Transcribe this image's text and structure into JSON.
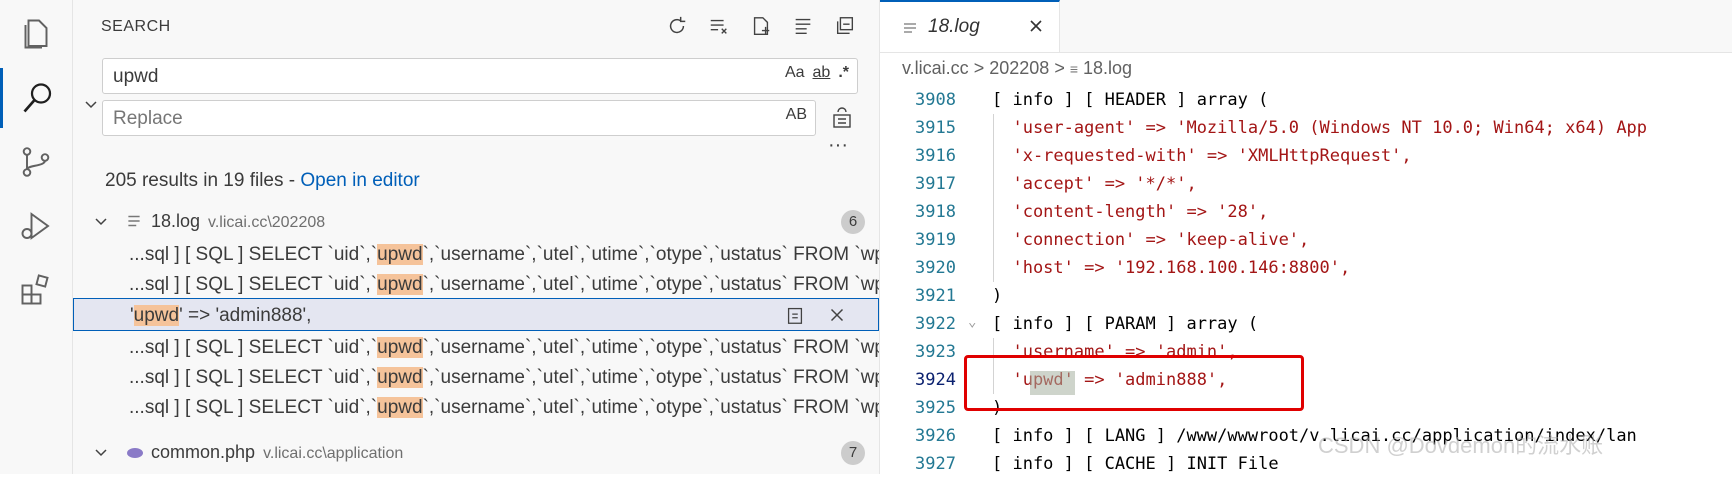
{
  "activity": {
    "items": [
      "explorer-icon",
      "search-icon",
      "source-control-icon",
      "run-debug-icon",
      "extensions-icon"
    ]
  },
  "sidebar": {
    "title": "SEARCH",
    "search_value": "upwd",
    "replace_placeholder": "Replace",
    "opt_case": "Aa",
    "opt_word": "ab",
    "opt_regex": ".*",
    "opt_preserve": "AB",
    "summary": "205 results in 19 files - ",
    "open_in_editor": "Open in editor",
    "more": "···"
  },
  "files": [
    {
      "name": "18.log",
      "path": "v.licai.cc\\202208",
      "count": "6"
    },
    {
      "name": "common.php",
      "path": "v.licai.cc\\application",
      "count": "7"
    }
  ],
  "matches": [
    {
      "pre": "...sql ] [ SQL ] SELECT `uid`,`",
      "hl": "upwd",
      "post": "`,`username`,`utel`,`utime`,`otype`,`ustatus` FROM `wp..."
    },
    {
      "pre": "...sql ] [ SQL ] SELECT `uid`,`",
      "hl": "upwd",
      "post": "`,`username`,`utel`,`utime`,`otype`,`ustatus` FROM `wp..."
    },
    {
      "pre": "'",
      "hl": "upwd",
      "post": "' => 'admin888',"
    },
    {
      "pre": "...sql ] [ SQL ] SELECT `uid`,`",
      "hl": "upwd",
      "post": "`,`username`,`utel`,`utime`,`otype`,`ustatus` FROM `wp..."
    },
    {
      "pre": "...sql ] [ SQL ] SELECT `uid`,`",
      "hl": "upwd",
      "post": "`,`username`,`utel`,`utime`,`otype`,`ustatus` FROM `wp..."
    },
    {
      "pre": "...sql ] [ SQL ] SELECT `uid`,`",
      "hl": "upwd",
      "post": "`,`username`,`utel`,`utime`,`otype`,`ustatus` FROM `wp..."
    }
  ],
  "editor": {
    "tab": "18.log",
    "breadcrumb": [
      "v.licai.cc",
      "202208",
      "18.log"
    ],
    "lines": [
      {
        "n": "3908",
        "t": "[ info ] [ HEADER ] array ("
      },
      {
        "n": "3915",
        "t": "  'user-agent' => 'Mozilla/5.0 (Windows NT 10.0; Win64; x64) App"
      },
      {
        "n": "3916",
        "t": "  'x-requested-with' => 'XMLHttpRequest',"
      },
      {
        "n": "3917",
        "t": "  'accept' => '*/*',"
      },
      {
        "n": "3918",
        "t": "  'content-length' => '28',"
      },
      {
        "n": "3919",
        "t": "  'connection' => 'keep-alive',"
      },
      {
        "n": "3920",
        "t": "  'host' => '192.168.100.146:8800',"
      },
      {
        "n": "3921",
        "t": ")"
      },
      {
        "n": "3922",
        "t": "[ info ] [ PARAM ] array ("
      },
      {
        "n": "3923",
        "t": "  'username' => 'admin',"
      },
      {
        "n": "3924",
        "t": "  'upwd' => 'admin888',"
      },
      {
        "n": "3925",
        "t": ")"
      },
      {
        "n": "3926",
        "t": "[ info ] [ LANG ] /www/wwwroot/v.licai.cc/application/index/lan"
      },
      {
        "n": "3927",
        "t": "[ info ] [ CACHE ] INIT File"
      }
    ],
    "watermark": "CSDN @Dovdemon的流水账"
  },
  "colors": {
    "accent": "#005fb8",
    "match": "#f5c39a",
    "box": "#e00000"
  }
}
